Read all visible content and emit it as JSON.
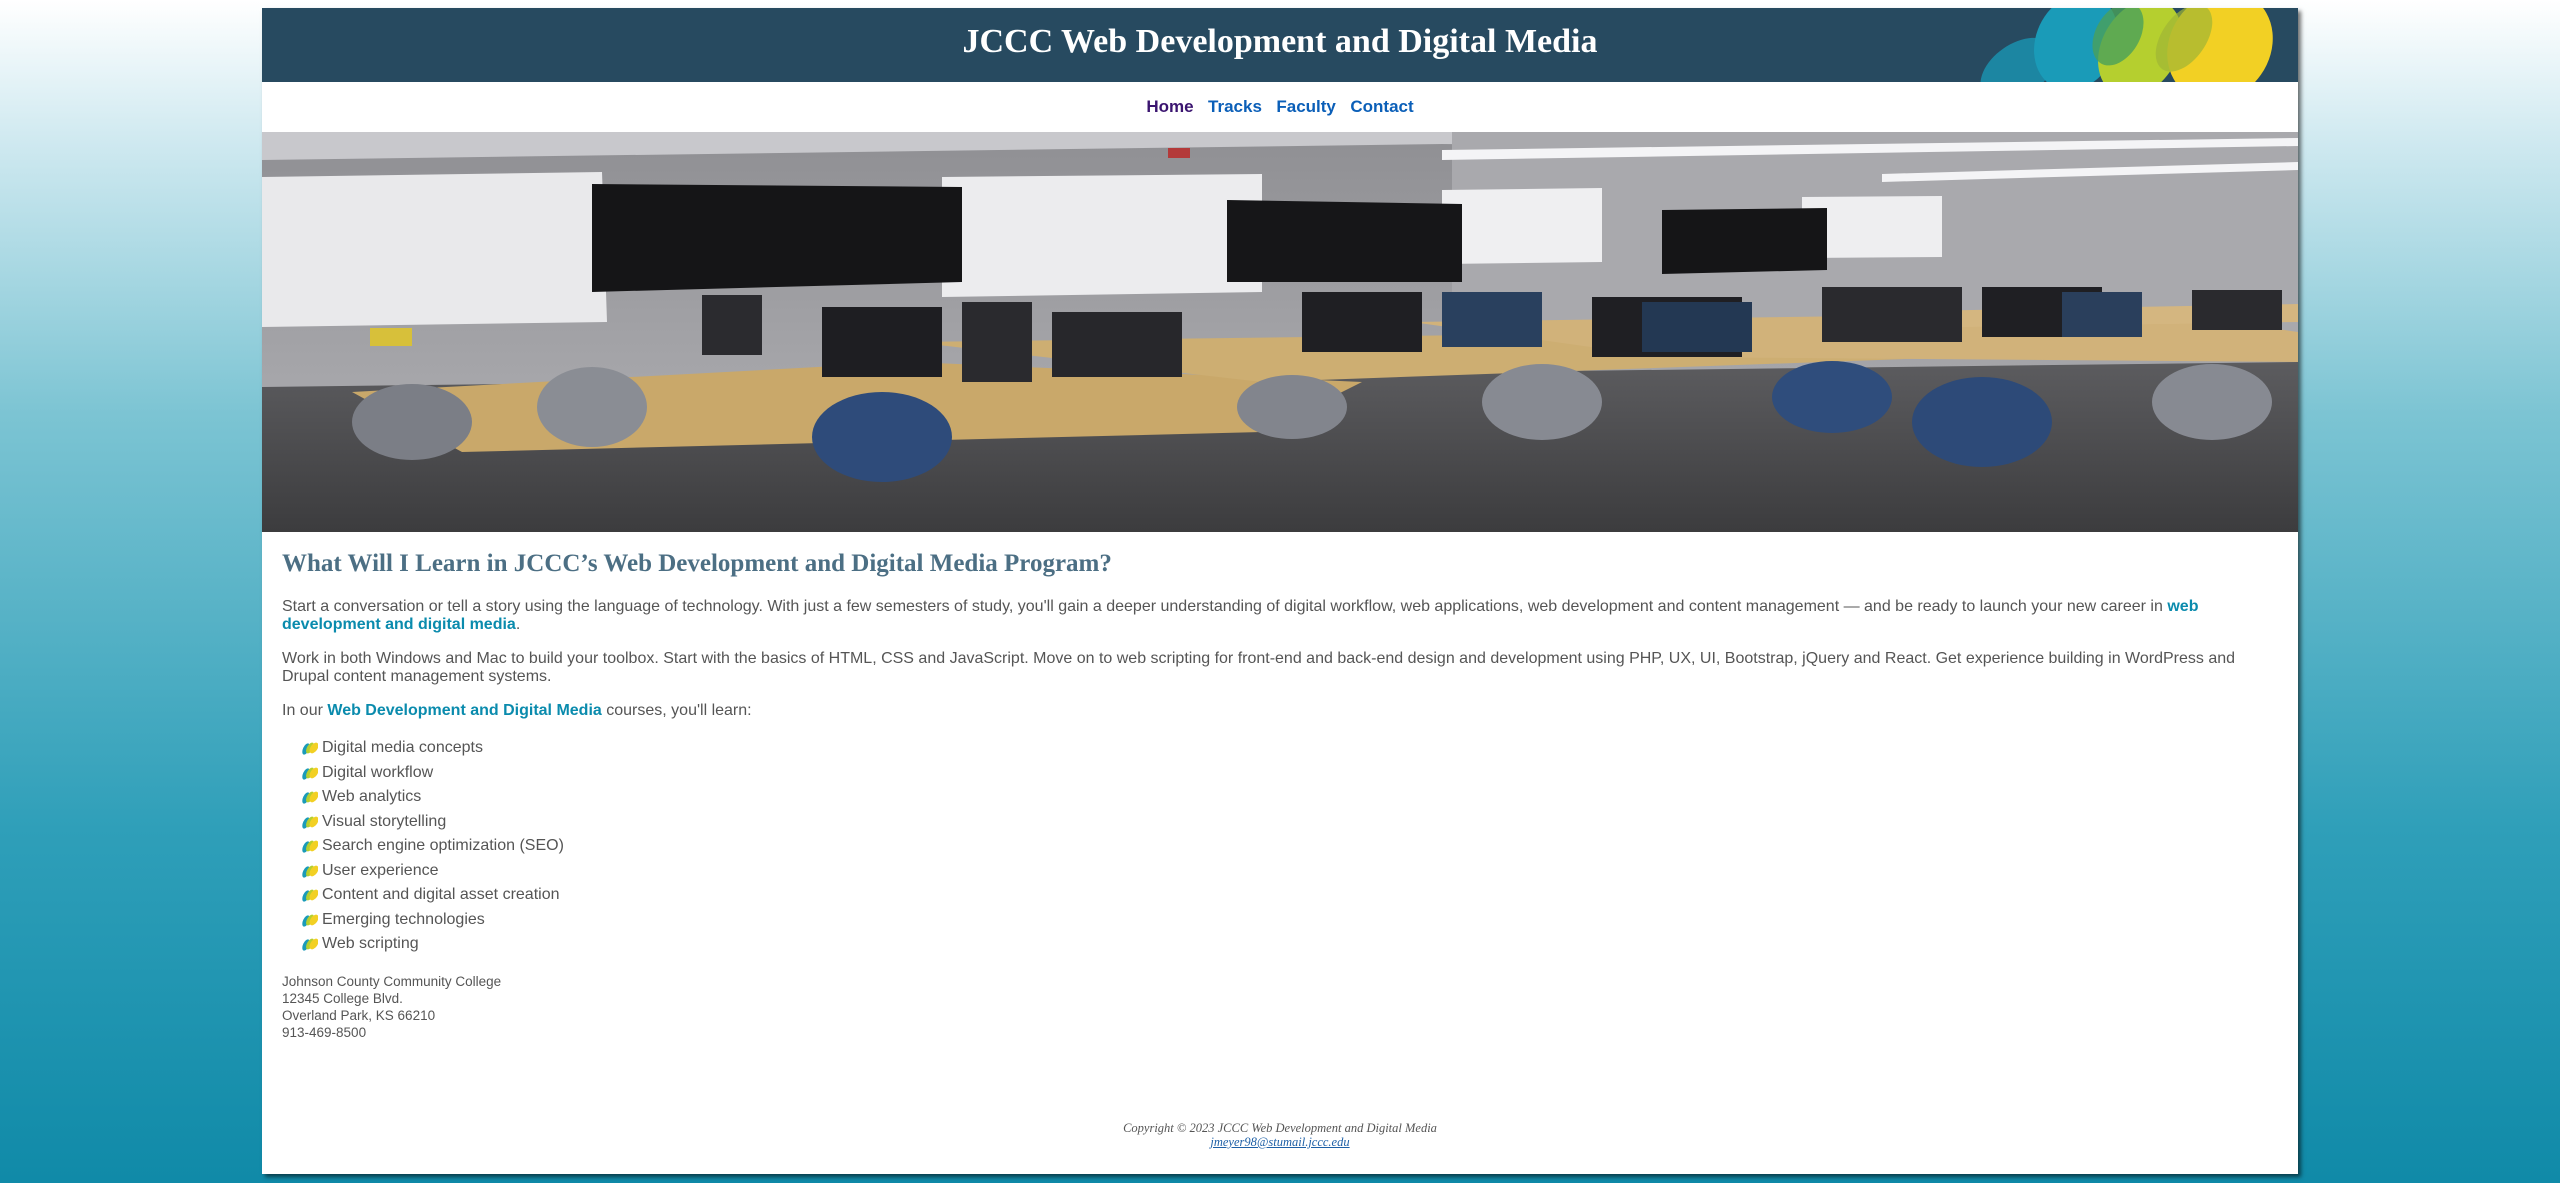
{
  "header": {
    "title": "JCCC Web Development and Digital Media"
  },
  "nav": {
    "items": [
      {
        "label": "Home",
        "current": true
      },
      {
        "label": "Tracks"
      },
      {
        "label": "Faculty"
      },
      {
        "label": "Contact"
      }
    ]
  },
  "hero": {
    "icon": "classroom-photo"
  },
  "main": {
    "heading": "What Will I Learn in JCCC’s Web Development and Digital Media Program?",
    "para1_text": "Start a conversation or tell a story using the language of technology. With just a few semesters of study, you'll gain a deeper understanding of digital workflow, web applications, web development and content management — and be ready to launch your new career in",
    "para1_link": "web development and digital media",
    "para1_end": ".",
    "para2": "Work in both Windows and Mac to build your toolbox. Start with the basics of HTML, CSS and JavaScript. Move on to web scripting for front-end and back-end design and development using PHP, UX, UI, Bootstrap, jQuery and React. Get experience building in WordPress and Drupal content management systems.",
    "para3_start": "In our",
    "para3_link": "Web Development and Digital Media",
    "para3_end": "courses, you'll learn:",
    "learn_items": [
      "Digital media concepts",
      "Digital workflow",
      "Web analytics",
      "Visual storytelling",
      "Search engine optimization (SEO)",
      "User experience",
      "Content and digital asset creation",
      "Emerging technologies",
      "Web scripting"
    ]
  },
  "address": {
    "line1": "Johnson County Community College",
    "line2": "12345 College Blvd.",
    "line3": "Overland Park, KS 66210",
    "line4": "913-469-8500"
  },
  "footer": {
    "copyright": "Copyright © 2023 JCCC Web Development and Digital Media",
    "email": "jmeyer98@stumail.jccc.edu"
  },
  "colors": {
    "header_bg": "#274a60",
    "link": "#0a8bad",
    "nav_link": "#0b5fb8",
    "nav_current": "#3b1570",
    "heading": "#4c6f84",
    "decor_teal": "#1a9bb8",
    "decor_green": "#b5cf2f",
    "decor_yellow": "#f2d024"
  }
}
